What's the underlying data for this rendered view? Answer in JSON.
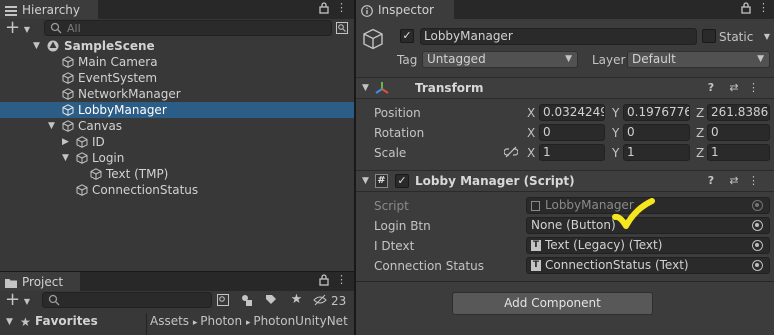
{
  "hierarchy": {
    "tab_label": "Hierarchy",
    "search_placeholder": "All",
    "add_label": "+",
    "items": [
      {
        "label": "SampleScene",
        "kind": "scene"
      },
      {
        "label": "Main Camera"
      },
      {
        "label": "EventSystem"
      },
      {
        "label": "NetworkManager"
      },
      {
        "label": "LobbyManager",
        "selected": true
      },
      {
        "label": "Canvas"
      },
      {
        "label": "ID"
      },
      {
        "label": "Login"
      },
      {
        "label": "Text (TMP)"
      },
      {
        "label": "ConnectionStatus"
      }
    ]
  },
  "project": {
    "tab_label": "Project",
    "add_label": "+",
    "hidden_count": "23",
    "favorites_label": "Favorites",
    "breadcrumb": [
      "Assets",
      "Photon",
      "PhotonUnityNet"
    ]
  },
  "inspector": {
    "tab_label": "Inspector",
    "object_name": "LobbyManager",
    "static_label": "Static",
    "tag_label": "Tag",
    "tag_value": "Untagged",
    "layer_label": "Layer",
    "layer_value": "Default",
    "transform": {
      "title": "Transform",
      "position_label": "Position",
      "rotation_label": "Rotation",
      "scale_label": "Scale",
      "position": {
        "x": "0.0324249",
        "y": "0.1976776",
        "z": "261.8386"
      },
      "rotation": {
        "x": "0",
        "y": "0",
        "z": "0"
      },
      "scale": {
        "x": "1",
        "y": "1",
        "z": "1"
      }
    },
    "script": {
      "title": "Lobby Manager (Script)",
      "script_label": "Script",
      "script_value": "LobbyManager",
      "login_btn_label": "Login Btn",
      "login_btn_value": "None (Button)",
      "idtext_label": "I Dtext",
      "idtext_value": "Text (Legacy) (Text)",
      "connection_label": "Connection Status",
      "connection_value": "ConnectionStatus (Text)"
    },
    "add_component_label": "Add Component"
  },
  "colors": {
    "selection": "#2c5d87",
    "panel": "#383838",
    "annotation_check": "#f5e61e"
  }
}
